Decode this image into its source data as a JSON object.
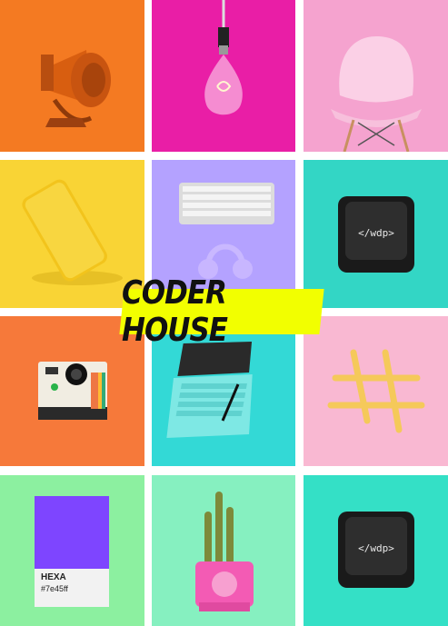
{
  "banner": {
    "text": "CODER HOUSE"
  },
  "tiles": {
    "keycap_label": "</wdp>",
    "keycap_label_2": "</wdp>",
    "swatch_name": "HEXA",
    "swatch_code": "#7e45ff"
  },
  "colors": {
    "orange": "#f47a22",
    "magenta": "#e91ea6",
    "pink": "#f5a3cf",
    "yellow": "#f9d435",
    "lavender": "#b4a2ff",
    "teal": "#33d6c5",
    "orange2": "#f6793a",
    "cyan": "#33d9d6",
    "lightpink": "#f9b8d2",
    "mint": "#8cf0a0",
    "mint2": "#86f0c0",
    "teal2": "#34e0c6",
    "banner": "#f2ff00",
    "swatch_purple": "#7e45ff"
  },
  "icons": [
    "megaphone-icon",
    "light-bulb-icon",
    "chair-icon",
    "phone-icon",
    "keyboard-icon",
    "headphones-icon",
    "keycap-icon",
    "camera-icon",
    "laptop-icon",
    "hashtag-icon",
    "color-swatch-icon",
    "cactus-icon"
  ]
}
